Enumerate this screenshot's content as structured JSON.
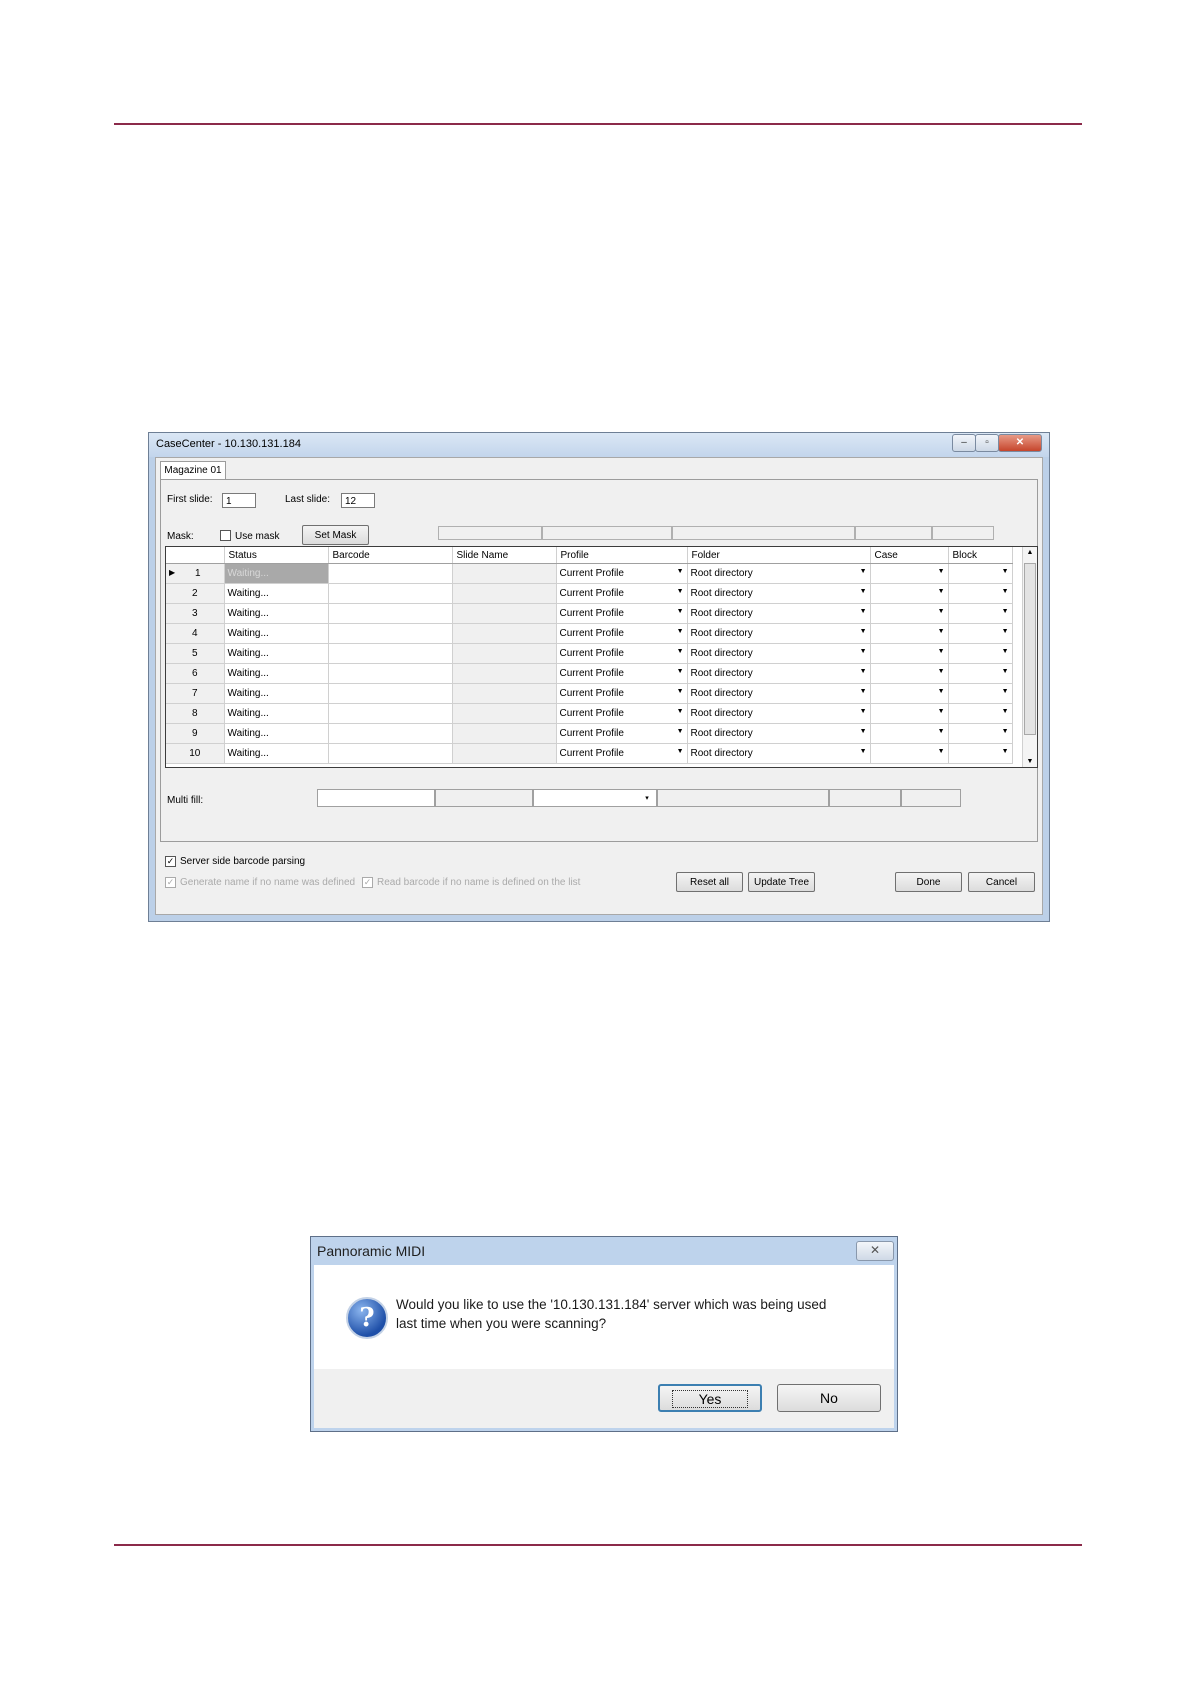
{
  "casecenter": {
    "title": "CaseCenter - 10.130.131.184",
    "window_controls": [
      "–",
      "▫",
      "✕"
    ],
    "tab": "Magazine 01",
    "first_slide_label": "First slide:",
    "first_slide_value": "1",
    "last_slide_label": "Last slide:",
    "last_slide_value": "12",
    "mask_label": "Mask:",
    "use_mask_label": "Use mask",
    "set_mask_button": "Set Mask",
    "columns": [
      "Status",
      "Barcode",
      "Slide Name",
      "Profile",
      "Folder",
      "Case",
      "Block"
    ],
    "rows": [
      {
        "num": "1",
        "status": "Waiting...",
        "profile": "Current Profile",
        "folder": "Root directory"
      },
      {
        "num": "2",
        "status": "Waiting...",
        "profile": "Current Profile",
        "folder": "Root directory"
      },
      {
        "num": "3",
        "status": "Waiting...",
        "profile": "Current Profile",
        "folder": "Root directory"
      },
      {
        "num": "4",
        "status": "Waiting...",
        "profile": "Current Profile",
        "folder": "Root directory"
      },
      {
        "num": "5",
        "status": "Waiting...",
        "profile": "Current Profile",
        "folder": "Root directory"
      },
      {
        "num": "6",
        "status": "Waiting...",
        "profile": "Current Profile",
        "folder": "Root directory"
      },
      {
        "num": "7",
        "status": "Waiting...",
        "profile": "Current Profile",
        "folder": "Root directory"
      },
      {
        "num": "8",
        "status": "Waiting...",
        "profile": "Current Profile",
        "folder": "Root directory"
      },
      {
        "num": "9",
        "status": "Waiting...",
        "profile": "Current Profile",
        "folder": "Root directory"
      },
      {
        "num": "10",
        "status": "Waiting...",
        "profile": "Current Profile",
        "folder": "Root directory"
      }
    ],
    "multi_fill_label": "Multi fill:",
    "server_side_label": "Server side barcode parsing",
    "generate_name_label": "Generate name if no name was defined",
    "read_barcode_label": "Read barcode if no name is defined on the list",
    "reset_all_button": "Reset all",
    "update_tree_button": "Update Tree",
    "done_button": "Done",
    "cancel_button": "Cancel"
  },
  "dialog": {
    "title": "Pannoramic MIDI",
    "close": "✕",
    "message_line1": "Would you like to use the '10.130.131.184' server which was being used",
    "message_line2": "last time when you were scanning?",
    "yes_button": "Yes",
    "no_button": "No"
  },
  "colors": {
    "rule": "#8b2a4a",
    "titlebar": "#c3d5ec"
  }
}
